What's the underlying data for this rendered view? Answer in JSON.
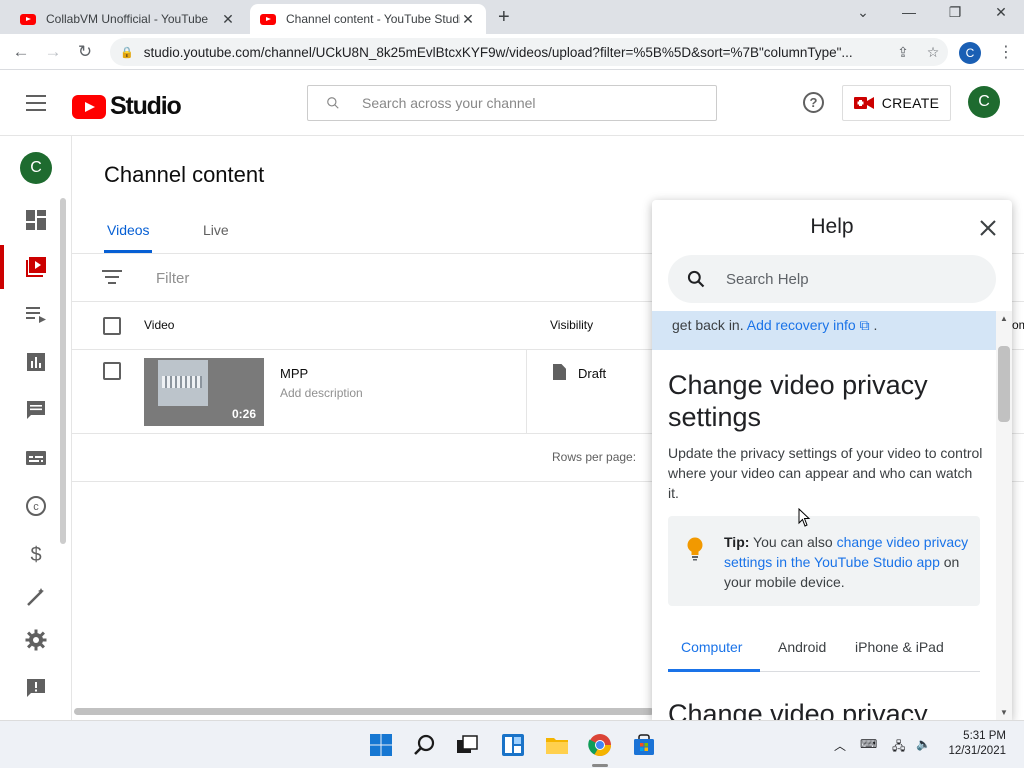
{
  "browser": {
    "tabs": [
      {
        "title": "CollabVM Unofficial - YouTube"
      },
      {
        "title": "Channel content - YouTube Studio"
      }
    ],
    "url": "studio.youtube.com/channel/UCkU8N_8k25mEvlBtcxKYF9w/videos/upload?filter=%5B%5D&sort=%7B\"columnType\"...",
    "profile_initial": "C"
  },
  "header": {
    "logo_text": "Studio",
    "search_placeholder": "Search across your channel",
    "create_label": "CREATE",
    "avatar_initial": "C"
  },
  "sidebar": {
    "avatar_initial": "C",
    "items": [
      {
        "icon": "dashboard-icon"
      },
      {
        "icon": "content-icon",
        "active": true
      },
      {
        "icon": "playlists-icon"
      },
      {
        "icon": "analytics-icon"
      },
      {
        "icon": "comments-icon"
      },
      {
        "icon": "subtitles-icon"
      },
      {
        "icon": "copyright-icon"
      },
      {
        "icon": "monetization-icon"
      },
      {
        "icon": "customization-icon"
      },
      {
        "icon": "settings-icon"
      },
      {
        "icon": "feedback-icon"
      }
    ]
  },
  "main": {
    "title": "Channel content",
    "tabs": [
      {
        "label": "Videos",
        "active": true
      },
      {
        "label": "Live"
      }
    ],
    "filter_placeholder": "Filter",
    "columns": {
      "video": "Video",
      "visibility": "Visibility",
      "clipped": "om"
    },
    "rows": [
      {
        "title": "MPP",
        "description": "Add description",
        "duration": "0:26",
        "visibility": "Draft"
      }
    ],
    "rows_per_page_label": "Rows per page:"
  },
  "help": {
    "title": "Help",
    "search_placeholder": "Search Help",
    "banner_text": "get back in.",
    "banner_link": "Add recovery info",
    "banner_end": ".",
    "heading": "Change video privacy settings",
    "paragraph": "Update the privacy settings of your video to control where your video can appear and who can watch it.",
    "tip_label": "Tip:",
    "tip_text_before": "You can also",
    "tip_link": "change video privacy settings in the YouTube Studio app",
    "tip_text_after": "on your mobile device.",
    "os_tabs": [
      {
        "label": "Computer",
        "active": true
      },
      {
        "label": "Android"
      },
      {
        "label": "iPhone & iPad"
      }
    ],
    "next_heading": "Change video privacy"
  },
  "taskbar": {
    "time": "5:31 PM",
    "date": "12/31/2021"
  },
  "colors": {
    "accent_blue": "#065fd4",
    "youtube_red": "#ff0000",
    "avatar_green": "#1e6b2f"
  }
}
